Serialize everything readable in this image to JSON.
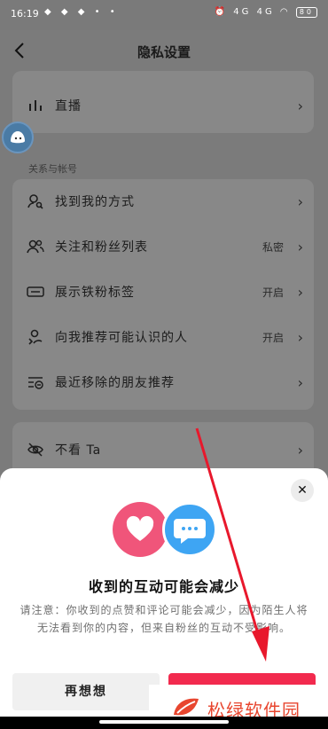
{
  "status_bar": {
    "time": "16:19",
    "app_icons": "◆ ◆ ◆",
    "dots": "• •",
    "signal_labels": "4G 4G",
    "battery": "80"
  },
  "nav": {
    "title": "隐私设置"
  },
  "section_label": "关系与帐号",
  "top_rows": [
    {
      "label": "直播",
      "icon": "bar-chart-icon"
    }
  ],
  "relation_rows": [
    {
      "label": "找到我的方式",
      "value": "",
      "icon": "search-user-icon"
    },
    {
      "label": "关注和粉丝列表",
      "value": "私密",
      "icon": "users-icon"
    },
    {
      "label": "展示铁粉标签",
      "value": "开启",
      "icon": "fan-badge-icon"
    },
    {
      "label": "向我推荐可能认识的人",
      "value": "开启",
      "icon": "recommend-user-icon"
    },
    {
      "label": "最近移除的朋友推荐",
      "value": "",
      "icon": "list-remove-icon"
    }
  ],
  "bottom_rows": [
    {
      "label": "不看 Ta",
      "icon": "eye-off-icon"
    }
  ],
  "dialog": {
    "title": "收到的互动可能会减少",
    "body": "请注意：你收到的点赞和评论可能会减少，因为陌生人将无法看到你的内容，但来自粉丝的互动不受影响。",
    "cancel_label": "再想想",
    "close_symbol": "✕"
  },
  "watermark": {
    "text": "松绿软件园"
  },
  "colors": {
    "accent": "#f22a4e",
    "heart": "#f0557a",
    "chat": "#3ea5f3",
    "watermark": "#e8462f"
  }
}
